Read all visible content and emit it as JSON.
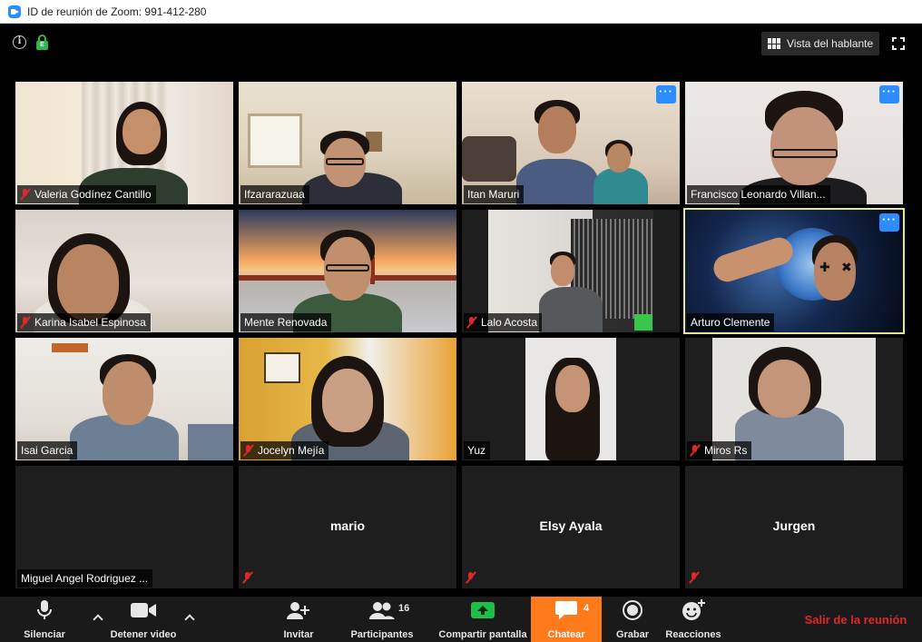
{
  "window": {
    "title": "ID de reunión de Zoom: 991-412-280"
  },
  "top": {
    "speaker_view_label": "Vista del hablante"
  },
  "participants": [
    {
      "name": "Valeria Godínez Cantillo",
      "muted": true
    },
    {
      "name": "Ifzararazuaa",
      "muted": false
    },
    {
      "name": "Itan Maruri",
      "muted": false
    },
    {
      "name": "Francisco Leonardo Villan...",
      "muted": false
    },
    {
      "name": "Karina Isabel Espinosa",
      "muted": true
    },
    {
      "name": "Mente Renovada",
      "muted": false
    },
    {
      "name": "Lalo Acosta",
      "muted": true
    },
    {
      "name": "Arturo Clemente",
      "muted": false,
      "active_speaker": true
    },
    {
      "name": "Isai Garcia",
      "muted": false
    },
    {
      "name": "Jocelyn Mejía",
      "muted": true
    },
    {
      "name": "Yuz",
      "muted": false
    },
    {
      "name": "Miros Rs",
      "muted": true
    },
    {
      "name": "Miguel Angel Rodriguez ...",
      "muted": false,
      "video_off": true
    },
    {
      "name": "mario",
      "muted": true,
      "video_off": true
    },
    {
      "name": "Elsy Ayala",
      "muted": true,
      "video_off": true
    },
    {
      "name": "Jurgen",
      "muted": true,
      "video_off": true
    }
  ],
  "toolbar": {
    "mute_label": "Silenciar",
    "video_label": "Detener video",
    "invite_label": "Invitar",
    "participants_label": "Participantes",
    "participants_count": "16",
    "share_label": "Compartir pantalla",
    "chat_label": "Chatear",
    "chat_count": "4",
    "record_label": "Grabar",
    "reactions_label": "Reacciones",
    "leave_label": "Salir de la reunión"
  },
  "colors": {
    "zoom_blue": "#2d8cff",
    "share_green": "#1fbe4b",
    "chat_orange": "#ff7a1a",
    "leave_red": "#e02828",
    "active_speaker_border": "#e5e889"
  }
}
